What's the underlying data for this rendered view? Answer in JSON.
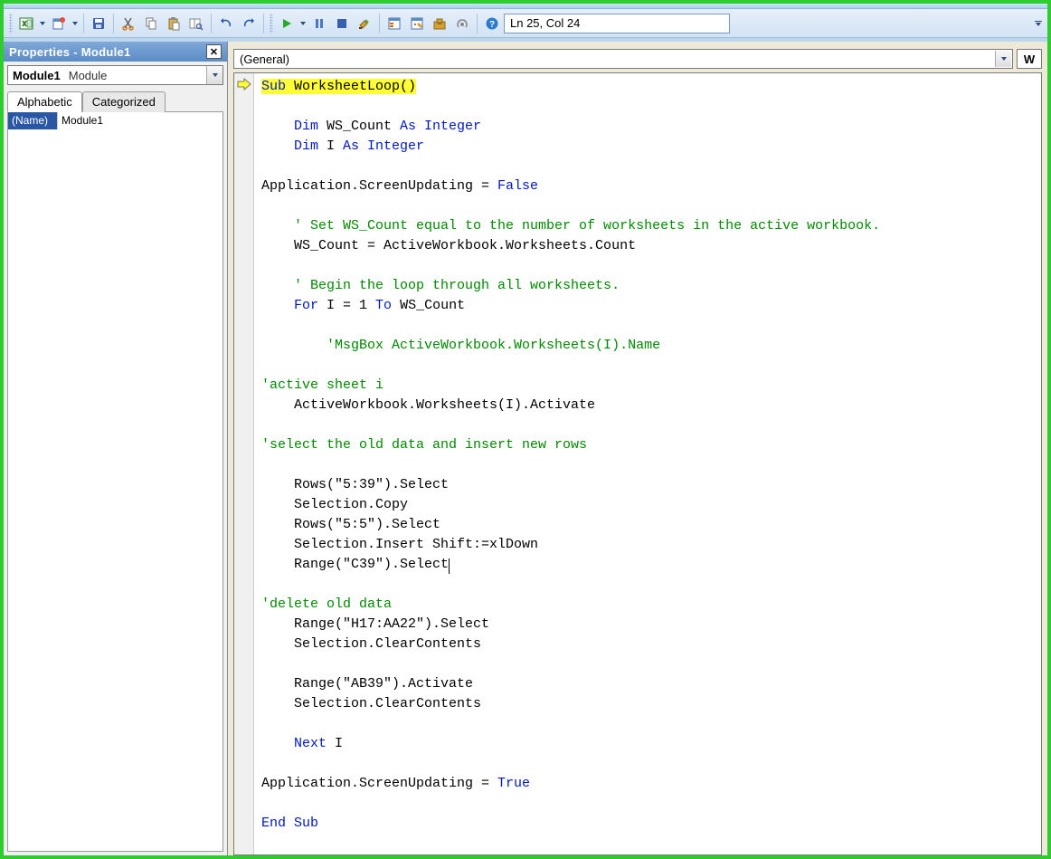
{
  "toolbar": {
    "lncol": "Ln 25, Col 24"
  },
  "properties": {
    "title": "Properties - Module1",
    "comboName": "Module1",
    "comboType": "Module",
    "tabs": {
      "alphabetic": "Alphabetic",
      "categorized": "Categorized"
    },
    "rows": [
      {
        "key": "(Name)",
        "value": "Module1"
      }
    ]
  },
  "codeTop": {
    "generalLabel": "(General)",
    "rightLabel": "W"
  },
  "code": {
    "l1a": "Sub",
    "l1b": " WorksheetLoop()",
    "l2": "",
    "l3a": "    ",
    "l3b": "Dim",
    "l3c": " WS_Count ",
    "l3d": "As Integer",
    "l4a": "    ",
    "l4b": "Dim",
    "l4c": " I ",
    "l4d": "As Integer",
    "l5": "",
    "l6a": "Application.ScreenUpdating = ",
    "l6b": "False",
    "l7": "",
    "l8": "    ' Set WS_Count equal to the number of worksheets in the active workbook.",
    "l9": "    WS_Count = ActiveWorkbook.Worksheets.Count",
    "l10": "",
    "l11": "    ' Begin the loop through all worksheets.",
    "l12a": "    ",
    "l12b": "For",
    "l12c": " I = 1 ",
    "l12d": "To",
    "l12e": " WS_Count",
    "l13": "",
    "l14": "        'MsgBox ActiveWorkbook.Worksheets(I).Name",
    "l15": "",
    "l16": "'active sheet i",
    "l17": "    ActiveWorkbook.Worksheets(I).Activate",
    "l18": "",
    "l19": "'select the old data and insert new rows",
    "l20": "",
    "l21": "    Rows(\"5:39\").Select",
    "l22": "    Selection.Copy",
    "l23": "    Rows(\"5:5\").Select",
    "l24": "    Selection.Insert Shift:=xlDown",
    "l25": "    Range(\"C39\").Select",
    "l26": "",
    "l27": "'delete old data",
    "l28": "    Range(\"H17:AA22\").Select",
    "l29": "    Selection.ClearContents",
    "l30": "",
    "l31": "    Range(\"AB39\").Activate",
    "l32": "    Selection.ClearContents",
    "l33": "",
    "l34a": "    ",
    "l34b": "Next",
    "l34c": " I",
    "l35": "",
    "l36a": "Application.ScreenUpdating = ",
    "l36b": "True",
    "l37": "",
    "l38": "End Sub"
  }
}
